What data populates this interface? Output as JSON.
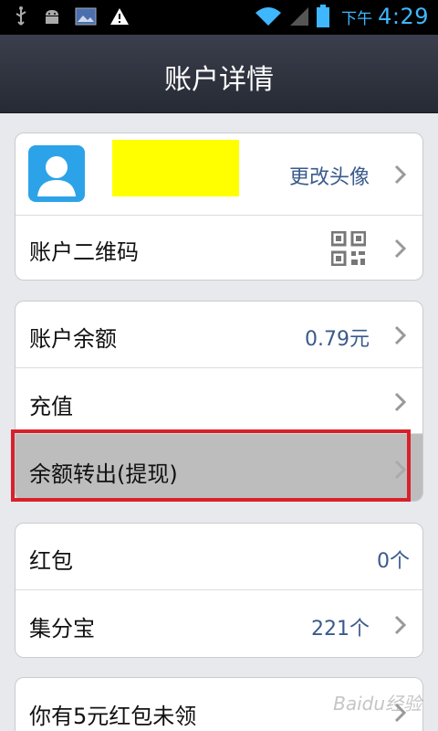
{
  "status_bar": {
    "ampm": "下午",
    "time": "4:29"
  },
  "header": {
    "title": "账户详情"
  },
  "groups": [
    {
      "rows": [
        {
          "label": "",
          "value": "更改头像"
        },
        {
          "label": "账户二维码",
          "value": ""
        }
      ]
    },
    {
      "rows": [
        {
          "label": "账户余额",
          "value": "0.79元"
        },
        {
          "label": "充值",
          "value": ""
        },
        {
          "label": "余额转出(提现)",
          "value": ""
        }
      ]
    },
    {
      "rows": [
        {
          "label": "红包",
          "value": "0个"
        },
        {
          "label": "集分宝",
          "value": "221个"
        }
      ]
    },
    {
      "rows": [
        {
          "label": "你有5元红包未领",
          "value": ""
        }
      ]
    }
  ],
  "watermark": "Baidu经验",
  "colors": {
    "accent_blue": "#3fb7ff",
    "value_text": "#3a5a8c",
    "highlight_box": "#d9202a",
    "redacted": "#ffff00"
  }
}
